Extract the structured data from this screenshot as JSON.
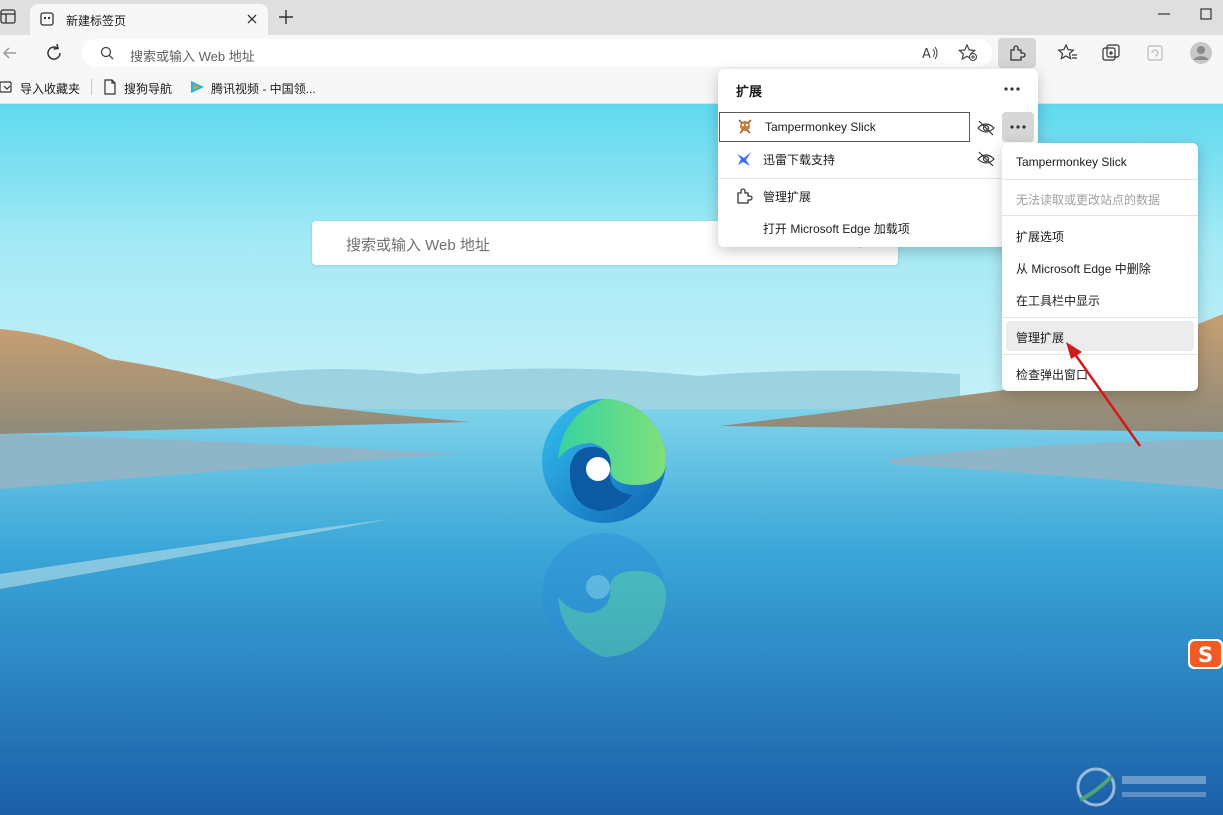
{
  "browser": {
    "tab": {
      "title": "新建标签页"
    },
    "address_bar": {
      "placeholder": "搜索或输入 Web 地址"
    },
    "favorites": [
      {
        "label": "导入收藏夹",
        "icon": "import-icon"
      },
      {
        "label": "搜狗导航",
        "icon": "page-icon"
      },
      {
        "label": "腾讯视频 - 中国领...",
        "icon": "tencent-video-icon"
      }
    ]
  },
  "new_tab_page": {
    "search_placeholder": "搜索或输入 Web 地址"
  },
  "extensions_panel": {
    "title": "扩展",
    "items": [
      {
        "label": "Tampermonkey Slick",
        "icon": "tampermonkey-icon"
      },
      {
        "label": "迅雷下载支持",
        "icon": "thunder-icon"
      }
    ],
    "manage_label": "管理扩展",
    "addons_label": "打开 Microsoft Edge 加载项"
  },
  "context_menu": {
    "header": "Tampermonkey Slick",
    "site_data": "无法读取或更改站点的数据",
    "options": "扩展选项",
    "remove": "从 Microsoft Edge 中删除",
    "show_toolbar": "在工具栏中显示",
    "manage": "管理扩展",
    "inspect": "检查弹出窗口"
  },
  "colors": {
    "accent": "#0078d4",
    "annotation_arrow": "#d3191c"
  }
}
